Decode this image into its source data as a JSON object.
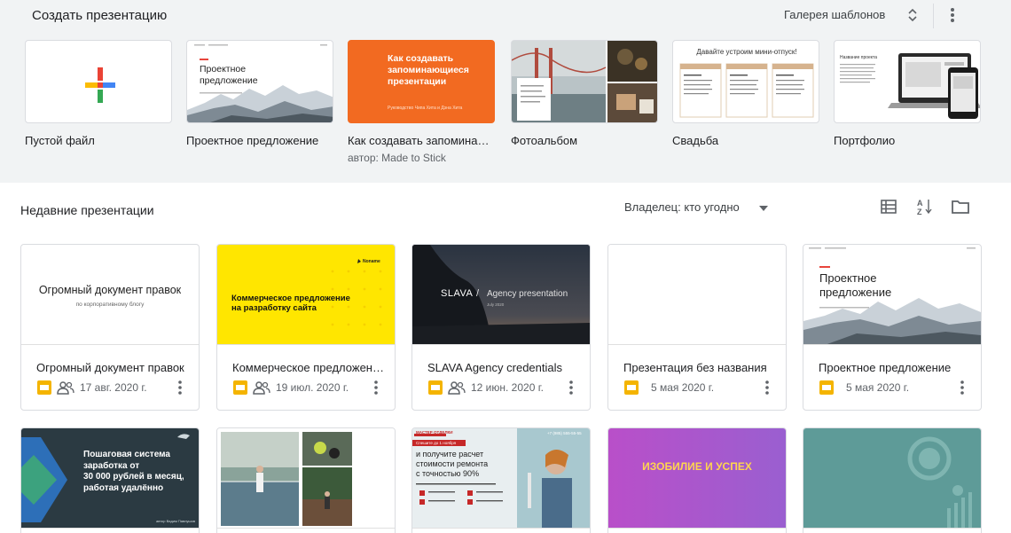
{
  "header": {
    "create_title": "Создать презентацию",
    "gallery_toggle": "Галерея шаблонов"
  },
  "templates": [
    {
      "name": "Пустой файл",
      "subtitle": ""
    },
    {
      "name": "Проектное предложение",
      "subtitle": "",
      "thumb_title": "Проектное\nпредложение"
    },
    {
      "name": "Как создавать запоминающиеся презентации",
      "subtitle": "автор: Made to Stick",
      "thumb_title": "Как создавать\nзапоминающиеся\nпрезентации",
      "thumb_caption": "Руководство Чипа Хита и Дэна Хита"
    },
    {
      "name": "Фотоальбом",
      "subtitle": ""
    },
    {
      "name": "Свадьба",
      "subtitle": "",
      "thumb_title": "Давайте устроим мини-отпуск!"
    },
    {
      "name": "Портфолио",
      "subtitle": "",
      "thumb_title": "Название проекта"
    }
  ],
  "recent": {
    "title": "Недавние презентации",
    "owner_filter": "Владелец: кто угодно"
  },
  "cards": [
    {
      "title": "Огромный документ правок",
      "date": "17 авг. 2020 г.",
      "shared": true,
      "thumb_title": "Огромный документ правок",
      "thumb_sub": "по корпоративному блогу"
    },
    {
      "title": "Коммерческое предложение на разработку сайта",
      "date": "19 июл. 2020 г.",
      "shared": true,
      "thumb_title": "Коммерческое предложение\nна разработку сайта",
      "thumb_logo": "Noname"
    },
    {
      "title": "SLAVA Agency credentials",
      "date": "12 июн. 2020 г.",
      "shared": true,
      "thumb_brand": "SLAVA",
      "thumb_title": "Agency presentation",
      "thumb_sub": "July 2020"
    },
    {
      "title": "Презентация без названия",
      "date": "5 мая 2020 г.",
      "shared": false
    },
    {
      "title": "Проектное предложение",
      "date": "5 мая 2020 г.",
      "shared": false,
      "thumb_title": "Проектное\nпредложение"
    }
  ],
  "cards_row2": [
    {
      "thumb_title": "Пошаговая система\nзаработка от\n30 000 рублей в месяц,\nработая удалённо",
      "thumb_author": "автор Вадим Павлушов"
    },
    {},
    {
      "thumb_brand": "МАСТЕР ОТДЕЛКИ",
      "thumb_badge": "Спешите до 1 ноября",
      "thumb_title": "и получите расчет\nстоимости ремонта\nс точностью 90%",
      "thumb_phone": "+7 (985) 555-55-55"
    },
    {
      "thumb_title": "ИЗОБИЛИЕ И УСПЕХ"
    },
    {}
  ],
  "colors": {
    "gallery_bg": "#f1f3f4",
    "slides_yellow": "#f4b400",
    "orange": "#f26a21",
    "card_yellow": "#ffe600",
    "purple_gradient": "#b94fc9",
    "teal": "#5e9b98"
  }
}
